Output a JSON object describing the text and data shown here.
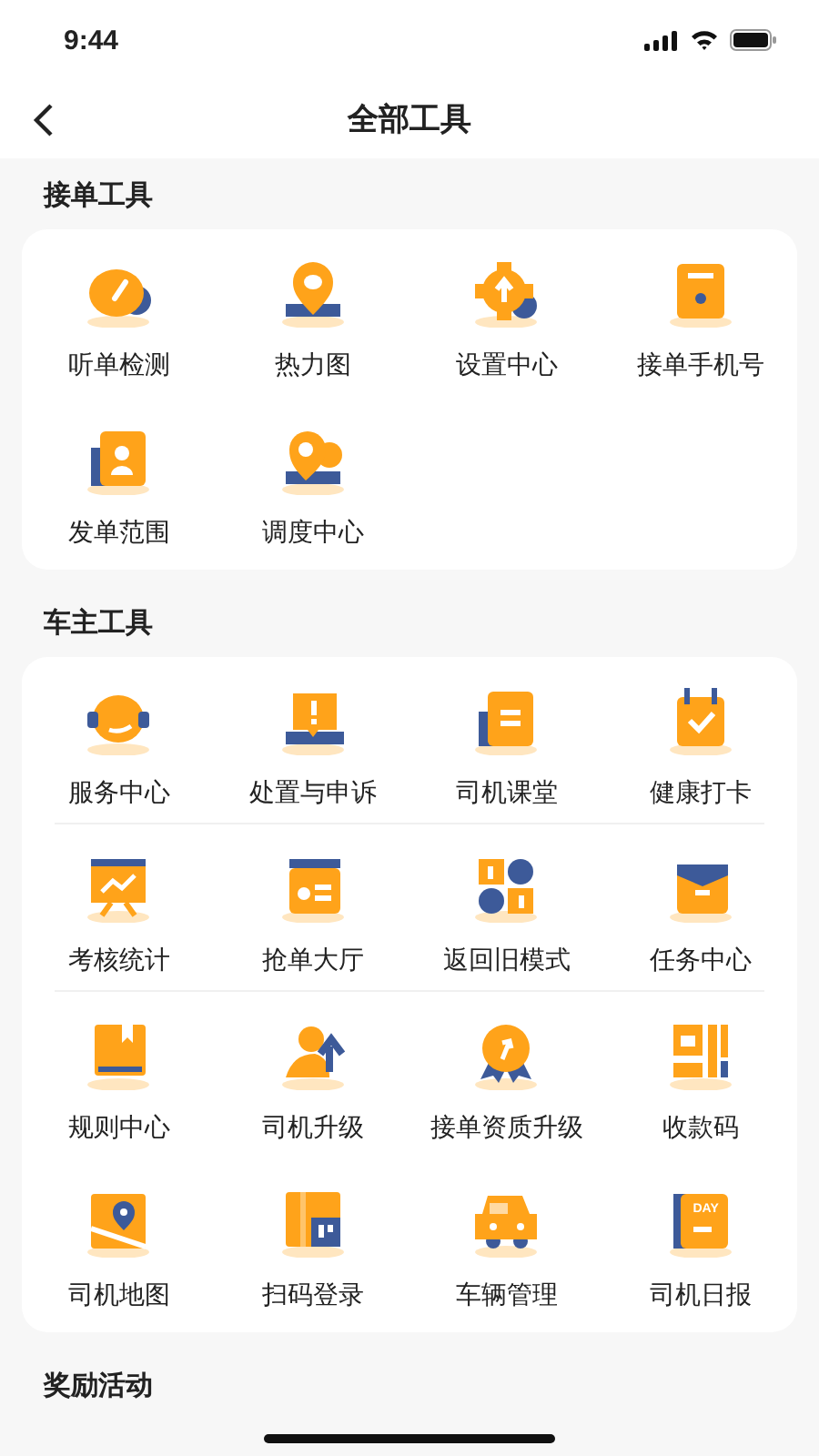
{
  "status_bar": {
    "time": "9:44"
  },
  "nav": {
    "title": "全部工具"
  },
  "sections": [
    {
      "title": "接单工具",
      "rows": [
        {
          "divider": false,
          "items": [
            {
              "label": "听单检测"
            },
            {
              "label": "热力图"
            },
            {
              "label": "设置中心"
            },
            {
              "label": "接单手机号"
            }
          ]
        },
        {
          "divider": false,
          "items": [
            {
              "label": "发单范围"
            },
            {
              "label": "调度中心"
            }
          ]
        }
      ]
    },
    {
      "title": "车主工具",
      "rows": [
        {
          "divider": true,
          "items": [
            {
              "label": "服务中心"
            },
            {
              "label": "处置与申诉"
            },
            {
              "label": "司机课堂"
            },
            {
              "label": "健康打卡"
            }
          ]
        },
        {
          "divider": true,
          "items": [
            {
              "label": "考核统计"
            },
            {
              "label": "抢单大厅"
            },
            {
              "label": "返回旧模式"
            },
            {
              "label": "任务中心"
            }
          ]
        },
        {
          "divider": false,
          "items": [
            {
              "label": "规则中心"
            },
            {
              "label": "司机升级"
            },
            {
              "label": "接单资质升级"
            },
            {
              "label": "收款码"
            }
          ]
        },
        {
          "divider": false,
          "items": [
            {
              "label": "司机地图"
            },
            {
              "label": "扫码登录"
            },
            {
              "label": "车辆管理"
            },
            {
              "label": "司机日报",
              "icon_text": "DAY"
            }
          ]
        }
      ]
    },
    {
      "title": "奖励活动"
    }
  ]
}
